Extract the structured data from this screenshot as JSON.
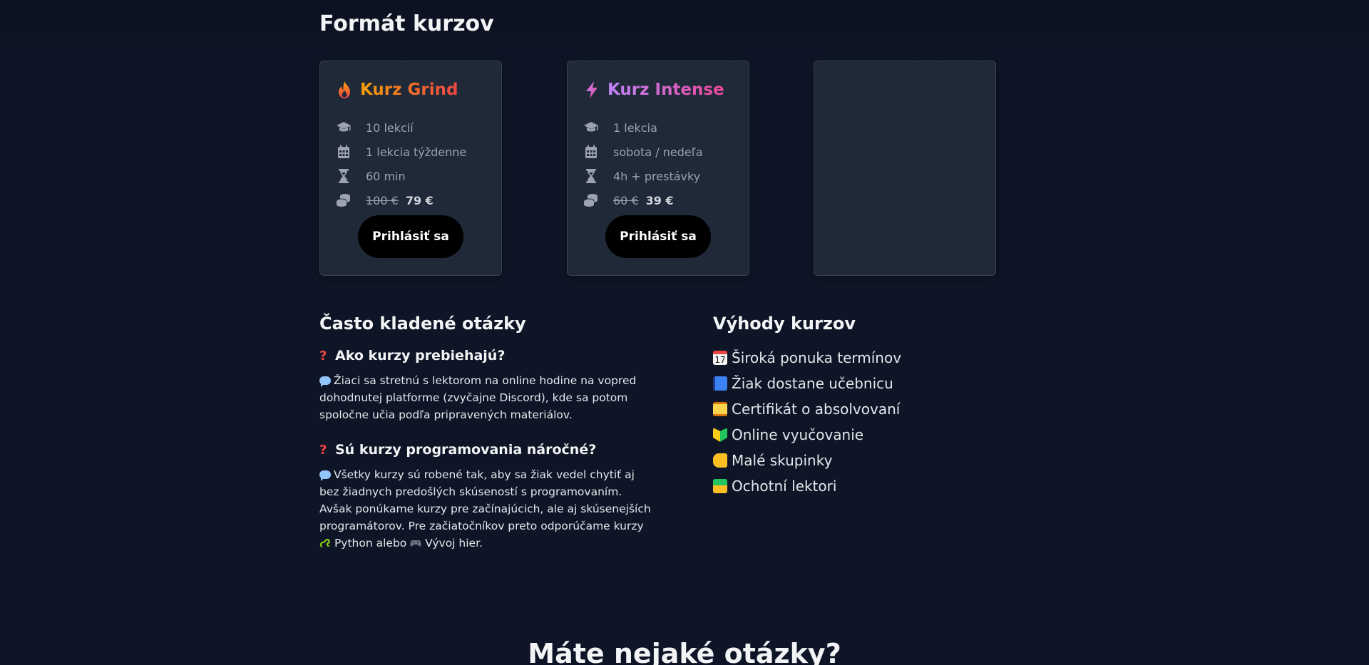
{
  "page": {
    "section_title": "Formát kurzov",
    "bottom_title": "Máte nejaké otázky?"
  },
  "cards": [
    {
      "title": "Kurz Grind",
      "icon": "fire-icon",
      "features": [
        {
          "icon": "graduation-cap-icon",
          "text": "10 lekcií"
        },
        {
          "icon": "calendar-icon",
          "text": "1 lekcia týždenne"
        },
        {
          "icon": "hourglass-icon",
          "text": "60 min"
        }
      ],
      "price_old": "100 €",
      "price_new": "79 €",
      "button": "Prihlásiť sa"
    },
    {
      "title": "Kurz Intense",
      "icon": "lightning-icon",
      "features": [
        {
          "icon": "graduation-cap-icon",
          "text": "1 lekcia"
        },
        {
          "icon": "calendar-icon",
          "text": "sobota / nedeľa"
        },
        {
          "icon": "hourglass-icon",
          "text": "4h + prestávky"
        }
      ],
      "price_old": "60 €",
      "price_new": "39 €",
      "button": "Prihlásiť sa"
    }
  ],
  "faq": {
    "title": "Často kladené otázky",
    "items": [
      {
        "question": "Ako kurzy prebiehajú?",
        "answer": "Žiaci sa stretnú s lektorom na online hodine na vopred dohodnutej platforme (zvyčajne Discord), kde sa potom spoločne učia podľa pripravených materiálov."
      },
      {
        "question": "Sú kurzy programovania náročné?",
        "answer_part1": "Všetky kurzy sú robené tak, aby sa žiak vedel chytiť aj bez žiadnych predošlých skúseností s programovaním. Avšak ponúkame kurzy pre začínajúcich, ale aj skúsenejších programátorov. Pre začiatočníkov preto odporúčame kurzy",
        "answer_link1": "Python",
        "answer_mid": "alebo",
        "answer_link2": "Vývoj hier."
      }
    ]
  },
  "benefits": {
    "title": "Výhody kurzov",
    "items": [
      {
        "icon": "calendar-emoji-icon",
        "text": "Široká ponuka termínov"
      },
      {
        "icon": "book-emoji-icon",
        "text": "Žiak dostane učebnicu"
      },
      {
        "icon": "scroll-emoji-icon",
        "text": "Certifikát o absolvovaní"
      },
      {
        "icon": "beginner-emoji-icon",
        "text": "Online vyučovanie"
      },
      {
        "icon": "pointing-hand-emoji-icon",
        "text": "Malé skupinky"
      },
      {
        "icon": "teacher-emoji-icon",
        "text": "Ochotní lektori"
      }
    ]
  },
  "colors": {
    "background": "#0e1526",
    "card": "#1f2937",
    "grind_gradient": [
      "#f59e0b",
      "#ef4444"
    ],
    "intense_gradient": [
      "#c084fc",
      "#ec4899"
    ],
    "button": "#000000"
  }
}
